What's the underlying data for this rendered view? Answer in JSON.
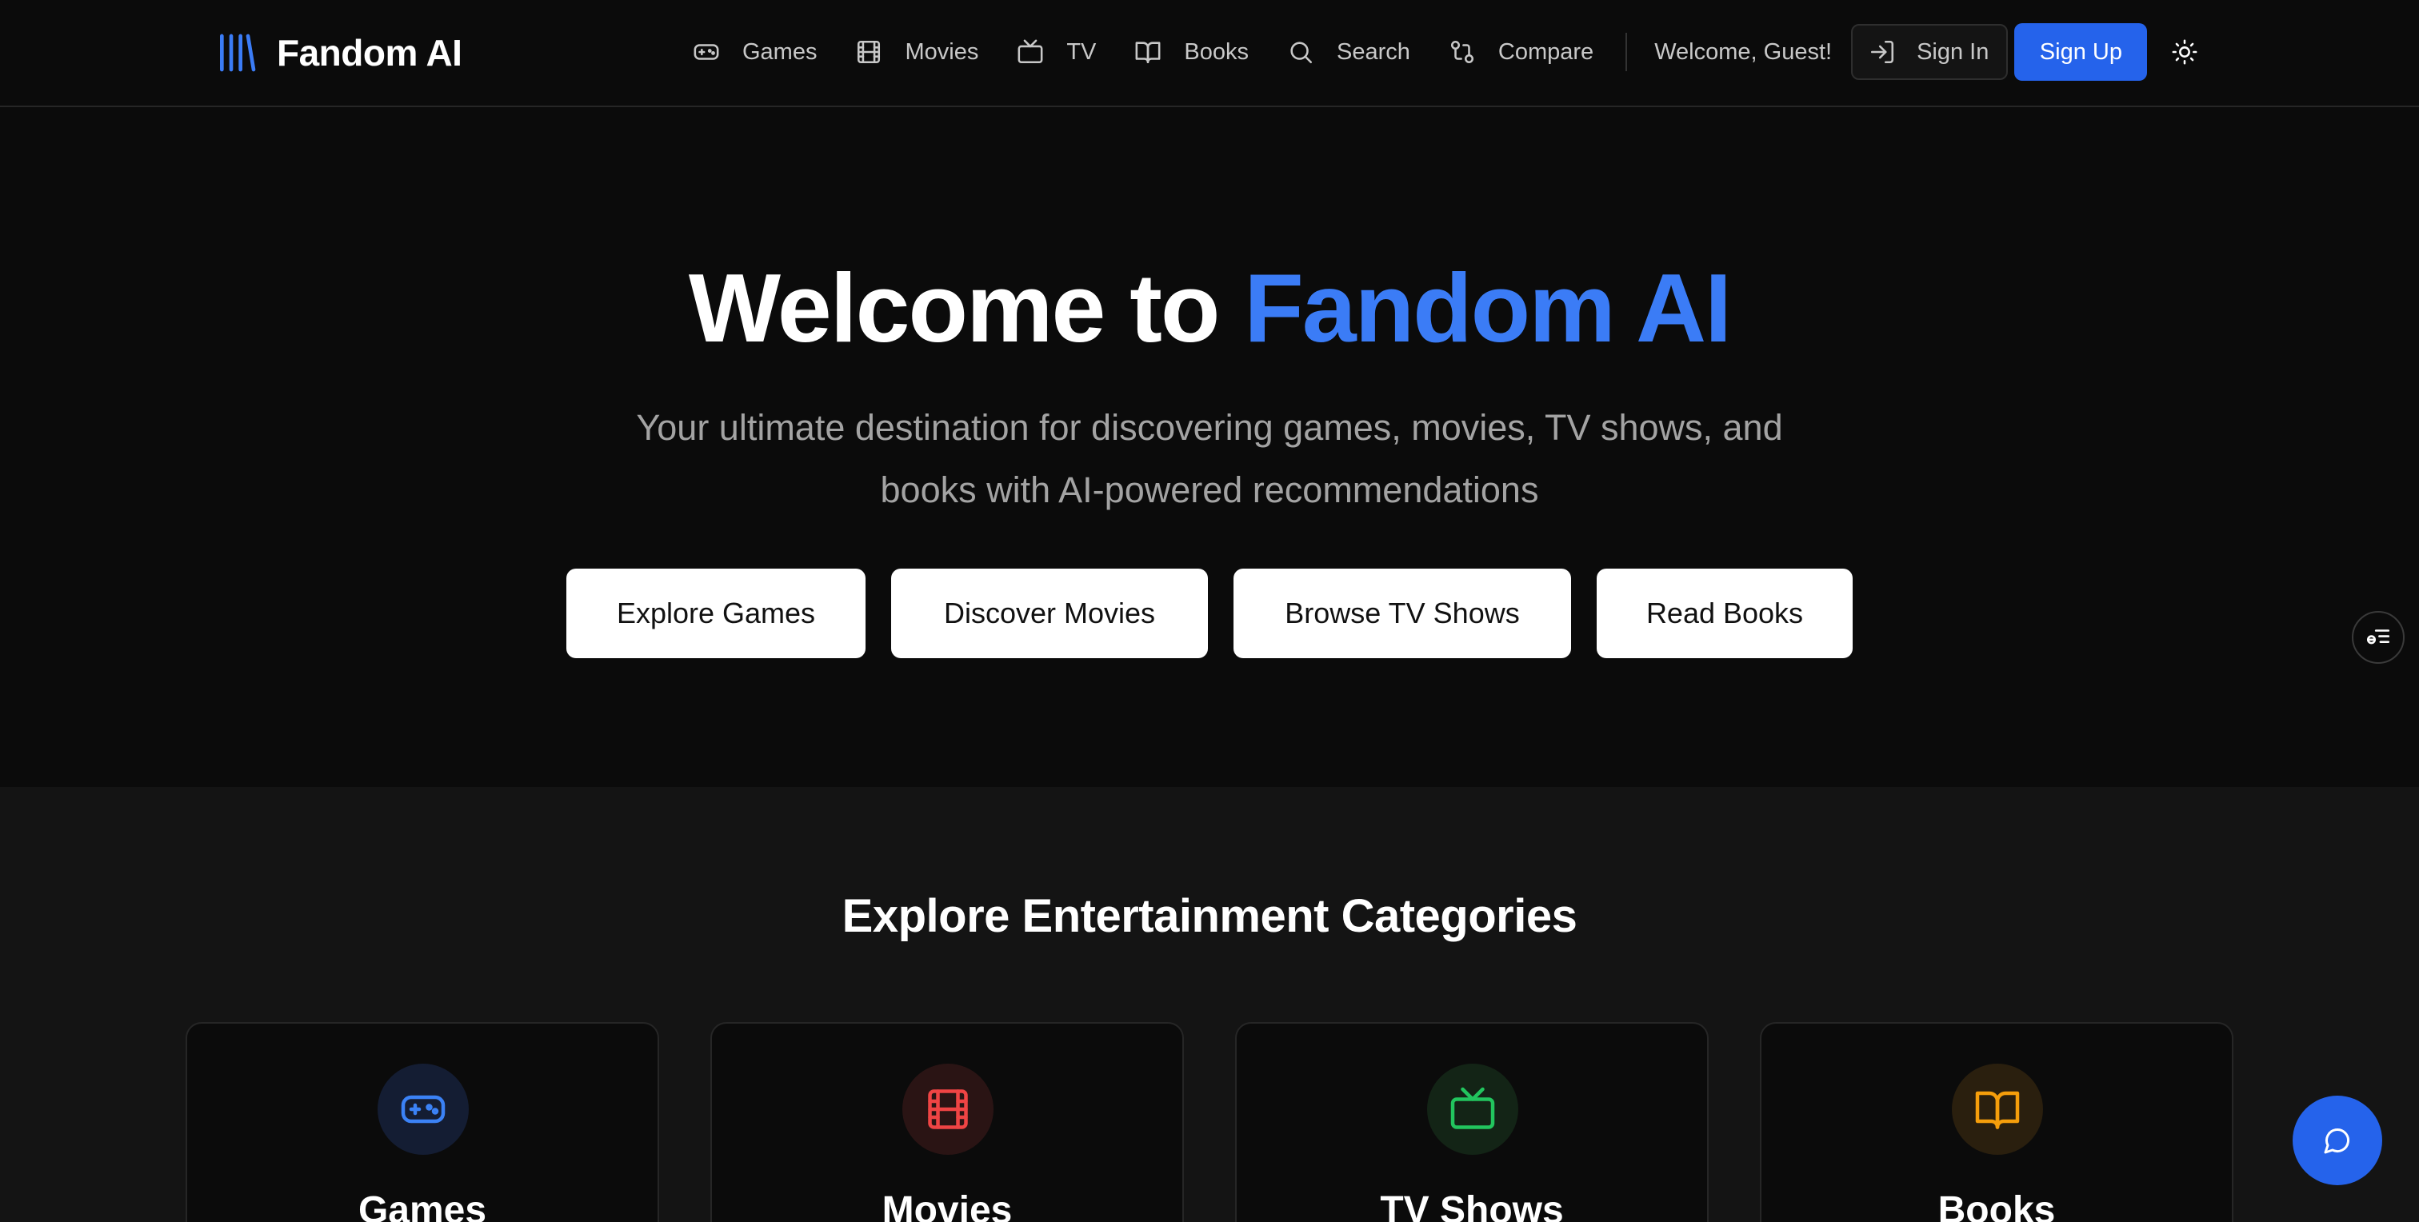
{
  "header": {
    "brand_name": "Fandom AI",
    "nav": [
      {
        "label": "Games",
        "icon": "gamepad-icon"
      },
      {
        "label": "Movies",
        "icon": "film-icon"
      },
      {
        "label": "TV",
        "icon": "tv-icon"
      },
      {
        "label": "Books",
        "icon": "book-open-icon"
      },
      {
        "label": "Search",
        "icon": "search-icon"
      },
      {
        "label": "Compare",
        "icon": "compare-icon"
      }
    ],
    "welcome_text": "Welcome, Guest!",
    "sign_in_label": "Sign In",
    "sign_up_label": "Sign Up"
  },
  "hero": {
    "title_prefix": "Welcome to ",
    "title_accent": "Fandom AI",
    "subtitle": "Your ultimate destination for discovering games, movies, TV shows, and books with AI-powered recommendations",
    "buttons": [
      "Explore Games",
      "Discover Movies",
      "Browse TV Shows",
      "Read Books"
    ]
  },
  "categories": {
    "heading": "Explore Entertainment Categories",
    "cards": [
      {
        "title": "Games",
        "icon": "gamepad-icon",
        "color": "#3b82f6"
      },
      {
        "title": "Movies",
        "icon": "film-icon",
        "color": "#ef4444"
      },
      {
        "title": "TV Shows",
        "icon": "tv-icon",
        "color": "#22c55e"
      },
      {
        "title": "Books",
        "icon": "book-open-icon",
        "color": "#f59e0b"
      }
    ]
  },
  "colors": {
    "accent": "#3b7cf6",
    "primary_button": "#2563eb",
    "background": "#0b0b0b",
    "section_background": "#141414"
  }
}
